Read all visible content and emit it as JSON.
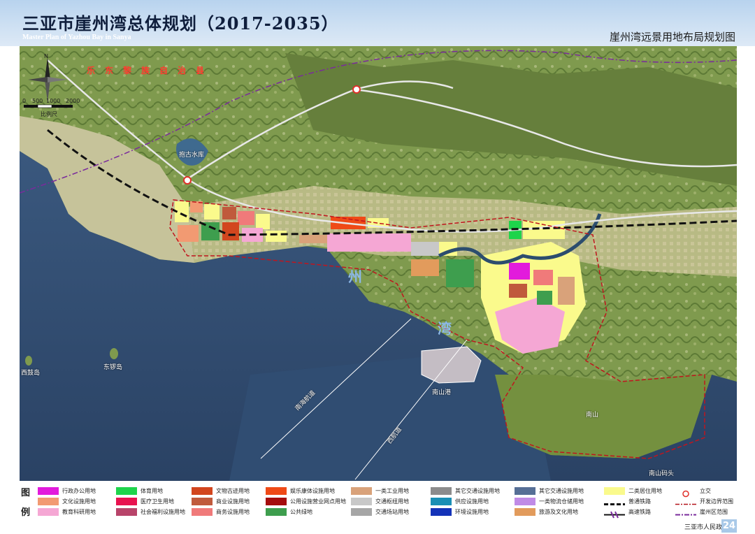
{
  "header": {
    "title": "三亚市崖州湾总体规划（2017-2035）",
    "subtitle_en": "Master Plan of Yazhou Bay  in Sanya",
    "map_title": "崖州湾远景用地布局规划图"
  },
  "map": {
    "labels": {
      "county": "乐东黎族自治县",
      "bay_1": "州",
      "bay_2": "湾",
      "scale_caption": "比例尺",
      "scale_ticks": [
        "0",
        "500",
        "1000",
        "2000"
      ],
      "north": "N",
      "island_west": "西鼓岛",
      "island_east": "东锣岛",
      "reservoir": "抱古水库",
      "port": "南山港",
      "nanshan": "南山",
      "channel_1": "南海航道",
      "channel_2": "西航道",
      "pier": "南山码头"
    }
  },
  "legend": {
    "title_1": "图",
    "title_2": "例",
    "items": [
      {
        "label": "行政办公用地",
        "color": "#e21bdc"
      },
      {
        "label": "文化设施用地",
        "color": "#f29a72"
      },
      {
        "label": "教育科研用地",
        "color": "#f5a7d4"
      },
      {
        "label": "体育用地",
        "color": "#1ed44b"
      },
      {
        "label": "医疗卫生用地",
        "color": "#e8124f"
      },
      {
        "label": "社会福利设施用地",
        "color": "#b8446a"
      },
      {
        "label": "文物古迹用地",
        "color": "#d2461e"
      },
      {
        "label": "商业设施用地",
        "color": "#c05a3c"
      },
      {
        "label": "商务设施用地",
        "color": "#f07a7a"
      },
      {
        "label": "娱乐康体设施用地",
        "color": "#ef4a17"
      },
      {
        "label": "公用设施营业网点用地",
        "color": "#a50d0d"
      },
      {
        "label": "公共绿地",
        "color": "#3e9e4e"
      },
      {
        "label": "一类工业用地",
        "color": "#d9a27a"
      },
      {
        "label": "交通枢纽用地",
        "color": "#c8c8c8"
      },
      {
        "label": "交通场站用地",
        "color": "#a6a6a6"
      },
      {
        "label": "其它交通设施用地",
        "color": "#8c8c8c"
      },
      {
        "label": "供应设施用地",
        "color": "#1a8fb5"
      },
      {
        "label": "环境设施用地",
        "color": "#1433b8"
      },
      {
        "label": "其它交通设施用地",
        "color": "#566f96"
      },
      {
        "label": "一类物流仓储用地",
        "color": "#c08be6"
      },
      {
        "label": "旅游及文化用地",
        "color": "#e29b5c"
      },
      {
        "label": "二类居住用地",
        "color": "#fafa8c"
      },
      {
        "label": "普通铁路",
        "color": "#111111"
      },
      {
        "label": "高速铁路",
        "color": "#111111"
      },
      {
        "label": "立交",
        "color": "#e0302a"
      },
      {
        "label": "开发边界范围",
        "color": "#b3121a"
      },
      {
        "label": "崖州区范围",
        "color": "#7a2b9c"
      }
    ]
  },
  "footer": {
    "government": "三亚市人民政府",
    "page": "24"
  }
}
